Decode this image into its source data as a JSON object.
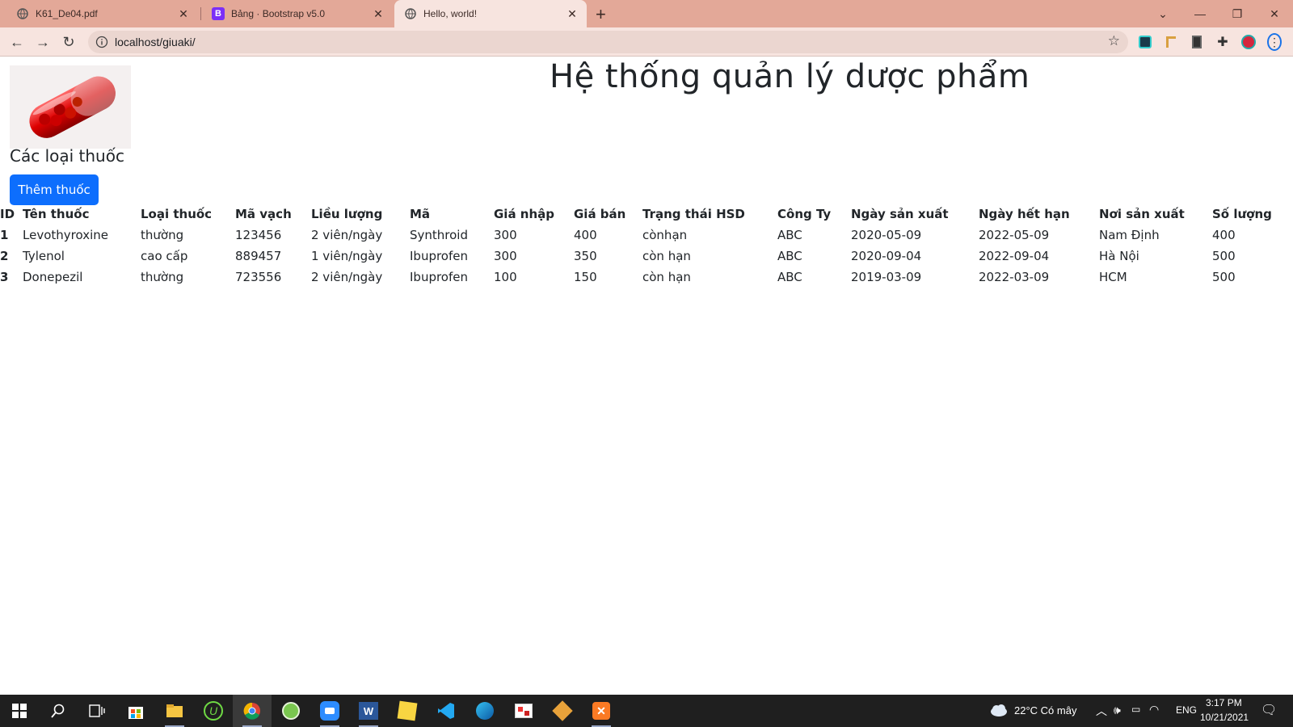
{
  "browser": {
    "tabs": [
      {
        "title": "K61_De04.pdf",
        "icon": "globe-icon"
      },
      {
        "title": "Bảng · Bootstrap v5.0",
        "icon": "bootstrap-icon"
      },
      {
        "title": "Hello, world!",
        "icon": "globe-icon",
        "active": true
      }
    ],
    "new_tab": "+",
    "url": "localhost/giuaki/"
  },
  "page": {
    "title": "Hệ thống quản lý dược phẩm",
    "subheading": "Các loại thuốc",
    "add_button": "Thêm thuốc",
    "table": {
      "headers": [
        "ID",
        "Tên thuốc",
        "Loại thuốc",
        "Mã vạch",
        "Liều lượng",
        "Mã",
        "Giá nhập",
        "Giá bán",
        "Trạng thái HSD",
        "Công Ty",
        "Ngày sản xuất",
        "Ngày hết hạn",
        "Nơi sản xuất",
        "Số lượng"
      ],
      "rows": [
        [
          "1",
          "Levothyroxine",
          "thường",
          "123456",
          "2 viên/ngày",
          "Synthroid",
          "300",
          "400",
          "cònhạn",
          "ABC",
          "2020-05-09",
          "2022-05-09",
          "Nam Định",
          "400"
        ],
        [
          "2",
          "Tylenol",
          "cao cấp",
          "889457",
          "1 viên/ngày",
          "Ibuprofen",
          "300",
          "350",
          "còn hạn",
          "ABC",
          "2020-09-04",
          "2022-09-04",
          "Hà Nội",
          "500"
        ],
        [
          "3",
          "Donepezil",
          "thường",
          "723556",
          "2 viên/ngày",
          "Ibuprofen",
          "100",
          "150",
          "còn hạn",
          "ABC",
          "2019-03-09",
          "2022-03-09",
          "HCM",
          "500"
        ]
      ]
    }
  },
  "taskbar": {
    "weather": "22°C  Có mây",
    "language": "ENG",
    "time": "3:17 PM",
    "date": "10/21/2021"
  },
  "colors": {
    "tab_strip": "#e3a898",
    "toolbar": "#f7e4df",
    "primary_button": "#0d6efd",
    "taskbar": "#1f1f1f"
  }
}
